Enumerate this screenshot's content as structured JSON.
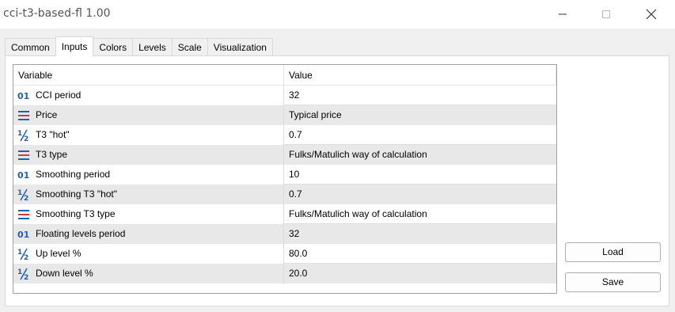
{
  "window": {
    "title": "cci-t3-based-fl 1.00"
  },
  "tabs": [
    "Common",
    "Inputs",
    "Colors",
    "Levels",
    "Scale",
    "Visualization"
  ],
  "active_tab": "Inputs",
  "table": {
    "headers": {
      "variable": "Variable",
      "value": "Value"
    },
    "rows": [
      {
        "icon": "integer-icon",
        "variable": "CCI period",
        "value": "32"
      },
      {
        "icon": "enum-icon",
        "variable": "Price",
        "value": "Typical price"
      },
      {
        "icon": "fraction-icon",
        "variable": "T3 \"hot\"",
        "value": "0.7"
      },
      {
        "icon": "enum-icon",
        "variable": "T3 type",
        "value": "Fulks/Matulich way of calculation"
      },
      {
        "icon": "integer-icon",
        "variable": "Smoothing period",
        "value": "10"
      },
      {
        "icon": "fraction-icon",
        "variable": "Smoothing T3 \"hot\"",
        "value": "0.7"
      },
      {
        "icon": "enum-icon",
        "variable": "Smoothing T3 type",
        "value": "Fulks/Matulich way of calculation"
      },
      {
        "icon": "integer-icon",
        "variable": "Floating levels period",
        "value": "32"
      },
      {
        "icon": "fraction-icon",
        "variable": "Up level %",
        "value": "80.0"
      },
      {
        "icon": "fraction-icon",
        "variable": "Down level %",
        "value": "20.0"
      }
    ]
  },
  "buttons": {
    "load": "Load",
    "save": "Save"
  },
  "colors": {
    "icon_blue": "#1f5fb4",
    "icon_red": "#d83b3b",
    "row_alt": "#e8e8e8"
  }
}
